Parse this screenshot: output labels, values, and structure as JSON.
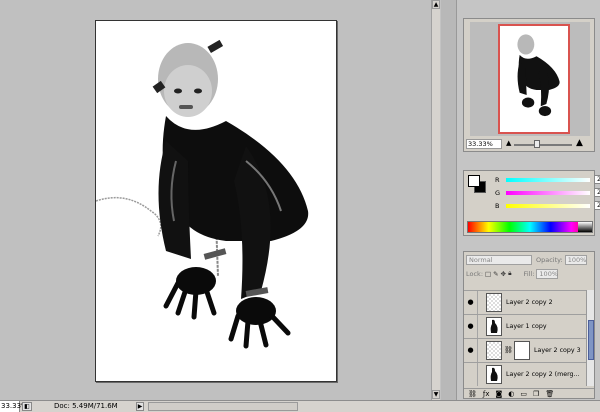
{
  "statusbar": {
    "zoom": "33.33%",
    "doc_info": "Doc: 5.49M/71.6M"
  },
  "navigator": {
    "zoom": "33.33%"
  },
  "color": {
    "channels": [
      {
        "label": "R",
        "value": "255",
        "gradient": "linear-gradient(to right,#00ffff,#ffffff)"
      },
      {
        "label": "G",
        "value": "255",
        "gradient": "linear-gradient(to right,#ff00ff,#ffffff)"
      },
      {
        "label": "B",
        "value": "255",
        "gradient": "linear-gradient(to right,#ffff00,#ffffff)"
      }
    ]
  },
  "layers": {
    "blend_mode": "Normal",
    "opacity_label": "Opacity:",
    "opacity": "100%",
    "lock_label": "Lock:",
    "fill_label": "Fill:",
    "fill": "100%",
    "items": [
      {
        "name": "Layer 2 copy 2",
        "visible": true
      },
      {
        "name": "Layer 1 copy",
        "visible": true
      },
      {
        "name": "Layer 2 copy 3",
        "visible": true
      },
      {
        "name": "Layer 2 copy 2 (merg...",
        "visible": false
      }
    ]
  },
  "icons": [
    "eye-icon",
    "link-icon",
    "fx-icon",
    "mask-icon",
    "folder-icon",
    "new-layer-icon",
    "trash-icon",
    "lock-icon",
    "brush-icon",
    "move-icon"
  ]
}
